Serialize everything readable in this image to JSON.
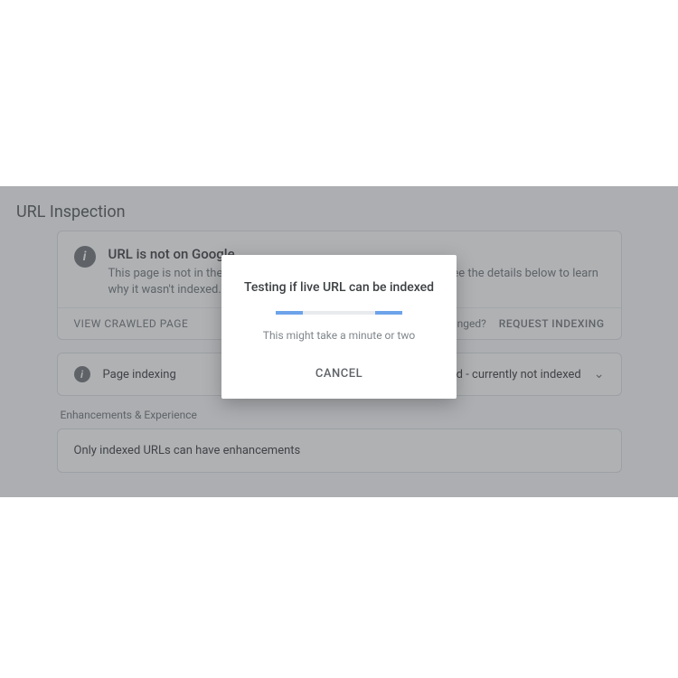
{
  "page": {
    "title": "URL Inspection"
  },
  "card1": {
    "heading": "URL is not on Google",
    "sub": "This page is not in the Google index, but not because of an error. See the details below to learn why it wasn't indexed.",
    "viewLabel": "VIEW CRAWLED PAGE",
    "pageChanged": "Page changed?",
    "requestLabel": "REQUEST INDEXING"
  },
  "card2": {
    "statusLeft": "Page indexing",
    "statusRight": "Discovered - currently not indexed"
  },
  "enhancements": {
    "sectionLabel": "Enhancements & Experience",
    "message": "Only indexed URLs can have enhancements"
  },
  "dialog": {
    "title": "Testing if live URL can be indexed",
    "subtitle": "This might take a minute or two",
    "cancelLabel": "CANCEL"
  }
}
